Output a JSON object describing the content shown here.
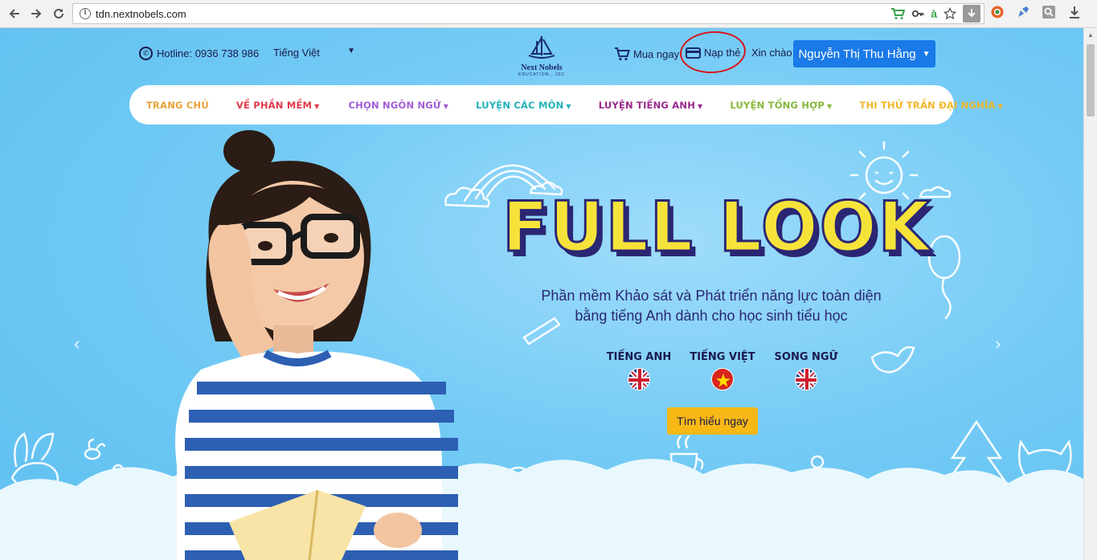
{
  "browser": {
    "url": "tdn.nextnobels.com",
    "back_icon": "arrow-left",
    "forward_icon": "arrow-right",
    "reload_icon": "reload",
    "info_icon": "info"
  },
  "header": {
    "hotline": "Hotline: 0936 738 986",
    "language": "Tiếng Việt",
    "logo_name": "Next Nobels",
    "logo_tagline": "EDUCATION., JSC",
    "buy_label": "Mua ngay",
    "topup_label": "Nạp thẻ",
    "greeting": "Xin chào",
    "user_name": "Nguyễn Thị Thu Hằng"
  },
  "menu": {
    "items": [
      {
        "label": "TRANG CHỦ",
        "color": "#e8a23a"
      },
      {
        "label": "VỀ PHẦN MỀM",
        "color": "#e2394b"
      },
      {
        "label": "CHỌN NGÔN NGỮ",
        "color": "#a05cd6"
      },
      {
        "label": "LUYỆN CÁC MÔN",
        "color": "#20b3b8"
      },
      {
        "label": "LUYỆN TIẾNG ANH",
        "color": "#9a2a8e"
      },
      {
        "label": "LUYỆN TỔNG HỢP",
        "color": "#86b83a"
      },
      {
        "label": "THI THỬ TRẦN ĐẠI NGHĨA",
        "color": "#f2b72a"
      }
    ]
  },
  "hero": {
    "title": "FULL LOOK",
    "subtitle_line1": "Phần mềm Khảo sát và Phát triển năng lực toàn diện",
    "subtitle_line2": "bằng tiếng Anh dành cho học sinh tiểu học",
    "options": [
      {
        "label": "TIẾNG ANH",
        "flag": "uk"
      },
      {
        "label": "TIẾNG VIỆT",
        "flag": "vn"
      },
      {
        "label": "SONG NGỮ",
        "flag": "uk"
      }
    ],
    "cta": "Tìm hiểu ngay"
  },
  "colors": {
    "accent": "#1a7ae8",
    "cta": "#f8b815",
    "title": "#f6e33a",
    "dark": "#2b2673",
    "highlight_circle": "#d8141b"
  }
}
